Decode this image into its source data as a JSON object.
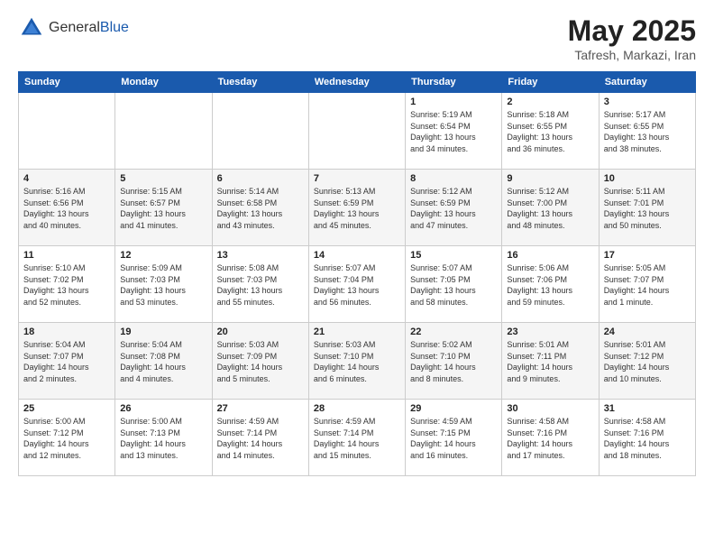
{
  "header": {
    "logo_general": "General",
    "logo_blue": "Blue",
    "month": "May 2025",
    "location": "Tafresh, Markazi, Iran"
  },
  "weekdays": [
    "Sunday",
    "Monday",
    "Tuesday",
    "Wednesday",
    "Thursday",
    "Friday",
    "Saturday"
  ],
  "weeks": [
    [
      {
        "day": "",
        "info": ""
      },
      {
        "day": "",
        "info": ""
      },
      {
        "day": "",
        "info": ""
      },
      {
        "day": "",
        "info": ""
      },
      {
        "day": "1",
        "info": "Sunrise: 5:19 AM\nSunset: 6:54 PM\nDaylight: 13 hours\nand 34 minutes."
      },
      {
        "day": "2",
        "info": "Sunrise: 5:18 AM\nSunset: 6:55 PM\nDaylight: 13 hours\nand 36 minutes."
      },
      {
        "day": "3",
        "info": "Sunrise: 5:17 AM\nSunset: 6:55 PM\nDaylight: 13 hours\nand 38 minutes."
      }
    ],
    [
      {
        "day": "4",
        "info": "Sunrise: 5:16 AM\nSunset: 6:56 PM\nDaylight: 13 hours\nand 40 minutes."
      },
      {
        "day": "5",
        "info": "Sunrise: 5:15 AM\nSunset: 6:57 PM\nDaylight: 13 hours\nand 41 minutes."
      },
      {
        "day": "6",
        "info": "Sunrise: 5:14 AM\nSunset: 6:58 PM\nDaylight: 13 hours\nand 43 minutes."
      },
      {
        "day": "7",
        "info": "Sunrise: 5:13 AM\nSunset: 6:59 PM\nDaylight: 13 hours\nand 45 minutes."
      },
      {
        "day": "8",
        "info": "Sunrise: 5:12 AM\nSunset: 6:59 PM\nDaylight: 13 hours\nand 47 minutes."
      },
      {
        "day": "9",
        "info": "Sunrise: 5:12 AM\nSunset: 7:00 PM\nDaylight: 13 hours\nand 48 minutes."
      },
      {
        "day": "10",
        "info": "Sunrise: 5:11 AM\nSunset: 7:01 PM\nDaylight: 13 hours\nand 50 minutes."
      }
    ],
    [
      {
        "day": "11",
        "info": "Sunrise: 5:10 AM\nSunset: 7:02 PM\nDaylight: 13 hours\nand 52 minutes."
      },
      {
        "day": "12",
        "info": "Sunrise: 5:09 AM\nSunset: 7:03 PM\nDaylight: 13 hours\nand 53 minutes."
      },
      {
        "day": "13",
        "info": "Sunrise: 5:08 AM\nSunset: 7:03 PM\nDaylight: 13 hours\nand 55 minutes."
      },
      {
        "day": "14",
        "info": "Sunrise: 5:07 AM\nSunset: 7:04 PM\nDaylight: 13 hours\nand 56 minutes."
      },
      {
        "day": "15",
        "info": "Sunrise: 5:07 AM\nSunset: 7:05 PM\nDaylight: 13 hours\nand 58 minutes."
      },
      {
        "day": "16",
        "info": "Sunrise: 5:06 AM\nSunset: 7:06 PM\nDaylight: 13 hours\nand 59 minutes."
      },
      {
        "day": "17",
        "info": "Sunrise: 5:05 AM\nSunset: 7:07 PM\nDaylight: 14 hours\nand 1 minute."
      }
    ],
    [
      {
        "day": "18",
        "info": "Sunrise: 5:04 AM\nSunset: 7:07 PM\nDaylight: 14 hours\nand 2 minutes."
      },
      {
        "day": "19",
        "info": "Sunrise: 5:04 AM\nSunset: 7:08 PM\nDaylight: 14 hours\nand 4 minutes."
      },
      {
        "day": "20",
        "info": "Sunrise: 5:03 AM\nSunset: 7:09 PM\nDaylight: 14 hours\nand 5 minutes."
      },
      {
        "day": "21",
        "info": "Sunrise: 5:03 AM\nSunset: 7:10 PM\nDaylight: 14 hours\nand 6 minutes."
      },
      {
        "day": "22",
        "info": "Sunrise: 5:02 AM\nSunset: 7:10 PM\nDaylight: 14 hours\nand 8 minutes."
      },
      {
        "day": "23",
        "info": "Sunrise: 5:01 AM\nSunset: 7:11 PM\nDaylight: 14 hours\nand 9 minutes."
      },
      {
        "day": "24",
        "info": "Sunrise: 5:01 AM\nSunset: 7:12 PM\nDaylight: 14 hours\nand 10 minutes."
      }
    ],
    [
      {
        "day": "25",
        "info": "Sunrise: 5:00 AM\nSunset: 7:12 PM\nDaylight: 14 hours\nand 12 minutes."
      },
      {
        "day": "26",
        "info": "Sunrise: 5:00 AM\nSunset: 7:13 PM\nDaylight: 14 hours\nand 13 minutes."
      },
      {
        "day": "27",
        "info": "Sunrise: 4:59 AM\nSunset: 7:14 PM\nDaylight: 14 hours\nand 14 minutes."
      },
      {
        "day": "28",
        "info": "Sunrise: 4:59 AM\nSunset: 7:14 PM\nDaylight: 14 hours\nand 15 minutes."
      },
      {
        "day": "29",
        "info": "Sunrise: 4:59 AM\nSunset: 7:15 PM\nDaylight: 14 hours\nand 16 minutes."
      },
      {
        "day": "30",
        "info": "Sunrise: 4:58 AM\nSunset: 7:16 PM\nDaylight: 14 hours\nand 17 minutes."
      },
      {
        "day": "31",
        "info": "Sunrise: 4:58 AM\nSunset: 7:16 PM\nDaylight: 14 hours\nand 18 minutes."
      }
    ]
  ]
}
